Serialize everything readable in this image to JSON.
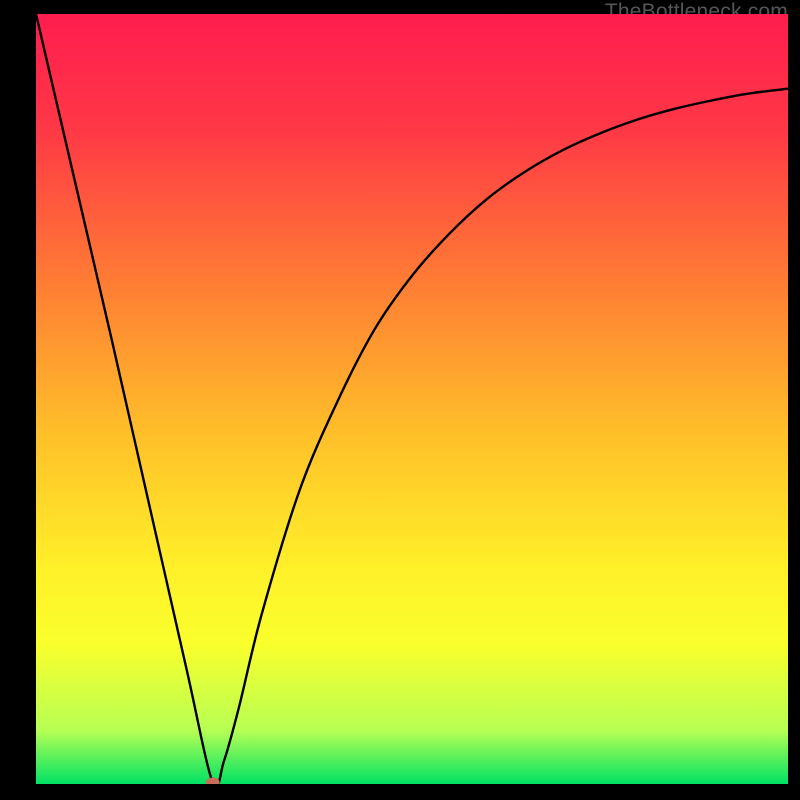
{
  "watermark": {
    "text": "TheBottleneck.com"
  },
  "chart_data": {
    "type": "line",
    "title": "",
    "xlabel": "",
    "ylabel": "",
    "xlim": [
      0,
      100
    ],
    "ylim": [
      0,
      100
    ],
    "grid": false,
    "legend": false,
    "background": {
      "type": "vertical-gradient",
      "stops": [
        {
          "pos": 0.0,
          "color": "#ff1d4f"
        },
        {
          "pos": 0.15,
          "color": "#ff3846"
        },
        {
          "pos": 0.35,
          "color": "#ff7d34"
        },
        {
          "pos": 0.55,
          "color": "#ffc129"
        },
        {
          "pos": 0.72,
          "color": "#fff029"
        },
        {
          "pos": 0.82,
          "color": "#f9ff2c"
        },
        {
          "pos": 0.93,
          "color": "#b7ff53"
        },
        {
          "pos": 1.0,
          "color": "#00e264"
        }
      ]
    },
    "series": [
      {
        "name": "bottleneck-curve",
        "color": "#000000",
        "stroke_width": 2.4,
        "x": [
          0,
          5,
          10,
          15,
          20,
          23.5,
          25,
          27,
          30,
          35,
          40,
          45,
          50,
          55,
          60,
          65,
          70,
          75,
          80,
          85,
          90,
          95,
          100
        ],
        "y": [
          100,
          79,
          58,
          36.5,
          15,
          0.2,
          3,
          10,
          22,
          38,
          49.5,
          59,
          66,
          71.5,
          76,
          79.5,
          82.3,
          84.5,
          86.3,
          87.7,
          88.8,
          89.7,
          90.3
        ]
      }
    ],
    "markers": [
      {
        "name": "min-point",
        "x": 23.5,
        "y": 0.2,
        "color": "#c76d5b",
        "rx": 7,
        "ry": 5
      }
    ]
  }
}
